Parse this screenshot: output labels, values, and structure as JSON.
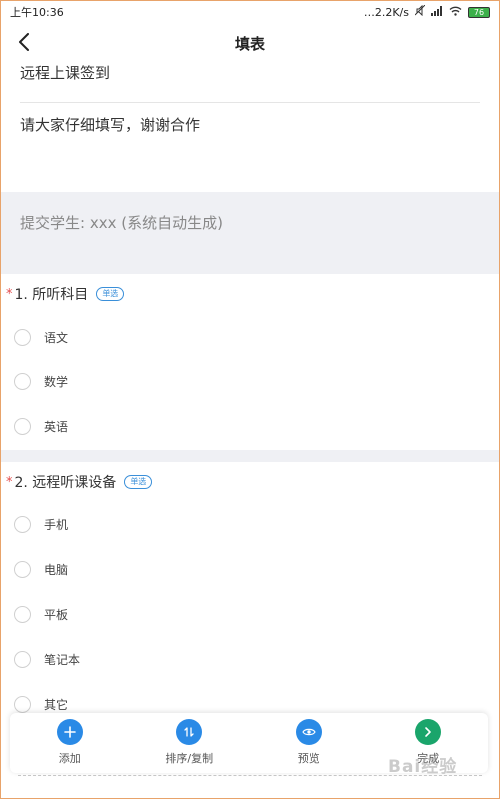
{
  "status_bar": {
    "time": "上午10:36",
    "network_speed": "…2.2K/s",
    "battery_level": "76"
  },
  "nav": {
    "title": "填表"
  },
  "form": {
    "title": "远程上课签到",
    "description": "请大家仔细填写，谢谢合作",
    "submitter_label": "提交学生: xxx (系统自动生成)"
  },
  "questions": [
    {
      "title": "1. 所听科目",
      "type_badge": "单选",
      "options": [
        "语文",
        "数学",
        "英语"
      ]
    },
    {
      "title": "2. 远程听课设备",
      "type_badge": "单选",
      "options": [
        "手机",
        "电脑",
        "平板",
        "笔记本",
        "其它"
      ]
    }
  ],
  "toolbar": {
    "items": [
      {
        "label": "添加",
        "icon": "plus-icon",
        "color": "#2a8ae6"
      },
      {
        "label": "排序/复制",
        "icon": "sort-icon",
        "color": "#2a8ae6"
      },
      {
        "label": "预览",
        "icon": "eye-icon",
        "color": "#2a8ae6"
      },
      {
        "label": "完成",
        "icon": "chevron-right-icon",
        "color": "#1aa56b"
      }
    ]
  },
  "watermark": "Bai经验",
  "colors": {
    "required_star": "#e34b4b",
    "badge": "#3a8fd9",
    "section_bg": "#eff0f4"
  }
}
